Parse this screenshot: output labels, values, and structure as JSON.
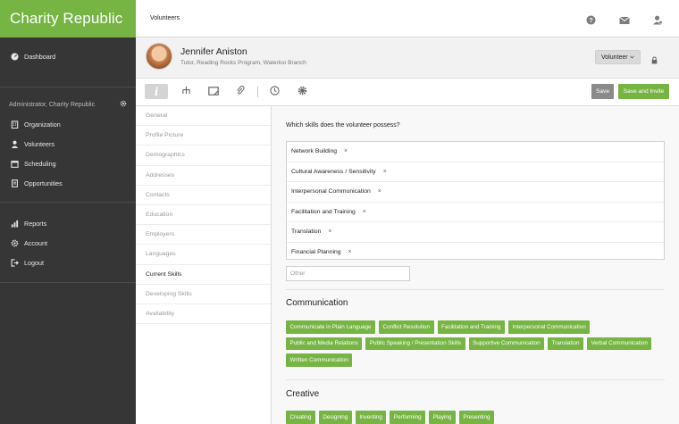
{
  "app": {
    "title": "Charity Republic"
  },
  "sidebar": {
    "nav_top": [
      {
        "label": "Dashboard",
        "icon": "dashboard-icon"
      }
    ],
    "org_label": "Administrator, Charity Republic",
    "nav_main": [
      {
        "label": "Organization",
        "icon": "building-icon"
      },
      {
        "label": "Volunteers",
        "icon": "user-icon"
      },
      {
        "label": "Scheduling",
        "icon": "calendar-icon"
      },
      {
        "label": "Opportunities",
        "icon": "document-icon"
      }
    ],
    "nav_bottom": [
      {
        "label": "Reports",
        "icon": "bar-chart-icon"
      },
      {
        "label": "Account",
        "icon": "gear-icon"
      },
      {
        "label": "Logout",
        "icon": "logout-icon"
      }
    ]
  },
  "topbar": {
    "breadcrumb": "Volunteers"
  },
  "profile": {
    "name": "Jennifer Aniston",
    "subtitle": "Tutor, Reading Rocks Program, Waterloo Branch",
    "role": "Volunteer"
  },
  "toolbar": {
    "info_glyph": "i",
    "save_label": "Save",
    "save_invite_label": "Save and Invite"
  },
  "sections": [
    {
      "label": "General",
      "active": false
    },
    {
      "label": "Profile Picture",
      "active": false
    },
    {
      "label": "Demographics",
      "active": false
    },
    {
      "label": "Addresses",
      "active": false
    },
    {
      "label": "Contacts",
      "active": false
    },
    {
      "label": "Education",
      "active": false
    },
    {
      "label": "Employers",
      "active": false
    },
    {
      "label": "Languages",
      "active": false
    },
    {
      "label": "Current Skills",
      "active": true
    },
    {
      "label": "Developing Skills",
      "active": false
    },
    {
      "label": "Availability",
      "active": false
    }
  ],
  "skills_form": {
    "question": "Which skills does the volunteer possess?",
    "remove_glyph": "×",
    "selected": [
      "Network Building",
      "Cultural Awareness / Sensitivity",
      "Interpersonal Communication",
      "Facilitation and Training",
      "Translation",
      "Financial Planning"
    ],
    "other_placeholder": "Other"
  },
  "categories": [
    {
      "title": "Communication",
      "tags": [
        "Communicate in Plain Language",
        "Conflict Resolution",
        "Facilitation and Training",
        "Interpersonal Communication",
        "Public and Media Relations",
        "Public Speaking / Presentation Skills",
        "Supportive Communication",
        "Translation",
        "Verbal Communication",
        "Written Communication"
      ]
    },
    {
      "title": "Creative",
      "tags": [
        "Creating",
        "Designing",
        "Inventing",
        "Performing",
        "Playing",
        "Presenting"
      ]
    }
  ],
  "colors": {
    "brand_green": "#76b443",
    "sidebar_bg": "#363636",
    "save_gray": "#8a8a8a"
  }
}
